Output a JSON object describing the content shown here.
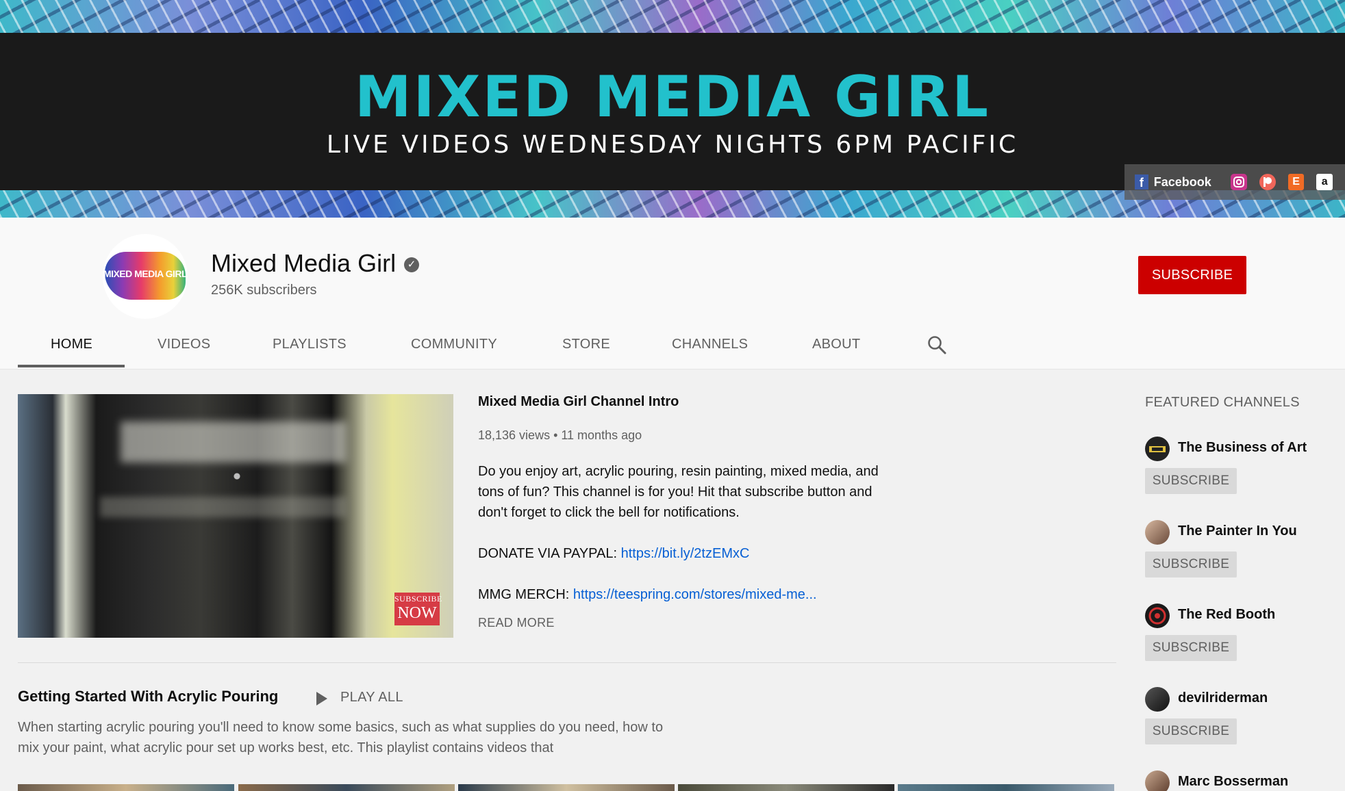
{
  "banner": {
    "title": "MIXED MEDIA GIRL",
    "subtitle": "LIVE VIDEOS WEDNESDAY NIGHTS 6PM PACIFIC",
    "links": {
      "facebook_icon": "f",
      "facebook_label": "Facebook",
      "icons": [
        "instagram-icon",
        "patreon-icon",
        "etsy-icon",
        "amazon-icon"
      ],
      "etsy_glyph": "E",
      "amazon_glyph": "a"
    }
  },
  "channel": {
    "avatar_text": "MIXED MEDIA GIRL",
    "name": "Mixed Media Girl",
    "verified_glyph": "✓",
    "subscribers": "256K subscribers",
    "subscribe_label": "SUBSCRIBE"
  },
  "tabs": {
    "items": [
      {
        "label": "HOME",
        "active": true
      },
      {
        "label": "VIDEOS",
        "active": false
      },
      {
        "label": "PLAYLISTS",
        "active": false
      },
      {
        "label": "COMMUNITY",
        "active": false
      },
      {
        "label": "STORE",
        "active": false
      },
      {
        "label": "CHANNELS",
        "active": false
      },
      {
        "label": "ABOUT",
        "active": false
      }
    ]
  },
  "featured_video": {
    "thumbnail_badge_top": "SUBSCRIBE",
    "thumbnail_badge_bottom": "NOW",
    "title": "Mixed Media Girl Channel Intro",
    "meta": "18,136 views • 11 months ago",
    "description": "Do you enjoy art, acrylic pouring, resin painting, mixed media, and tons of fun? This channel is for you! Hit that subscribe button and don't forget to click the bell for notifications.",
    "donate_label": "DONATE VIA PAYPAL: ",
    "donate_link": "https://bit.ly/2tzEMxC",
    "merch_label": "MMG MERCH: ",
    "merch_link": "https://teespring.com/stores/mixed-me...",
    "read_more": "READ MORE"
  },
  "shelf": {
    "title": "Getting Started With Acrylic Pouring",
    "play_all": "PLAY ALL",
    "description": "When starting acrylic pouring you'll need to know some basics, such as what supplies do you need, how to mix your paint, what acrylic pour set up works best, etc. This playlist contains videos that"
  },
  "featured_channels": {
    "heading": "FEATURED CHANNELS",
    "items": [
      {
        "name": "The Business of Art",
        "subscribe": "SUBSCRIBE"
      },
      {
        "name": "The Painter In You",
        "subscribe": "SUBSCRIBE"
      },
      {
        "name": "The Red Booth",
        "subscribe": "SUBSCRIBE"
      },
      {
        "name": "devilriderman",
        "subscribe": "SUBSCRIBE"
      },
      {
        "name": "Marc Bosserman",
        "subscribe": ""
      }
    ]
  },
  "colors": {
    "accent_red": "#cc0000",
    "banner_title": "#22c1cc",
    "link_blue": "#065fd4"
  }
}
